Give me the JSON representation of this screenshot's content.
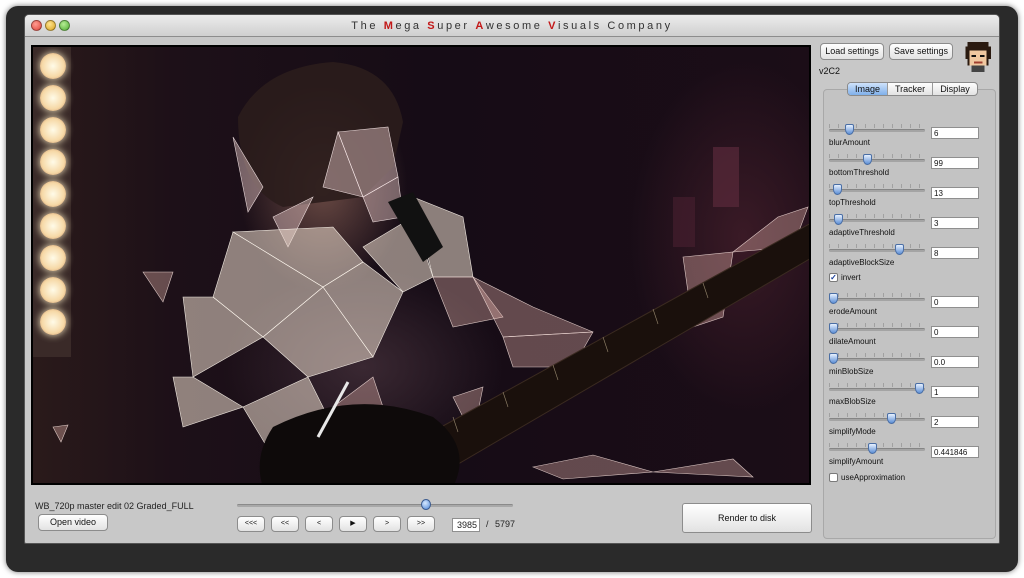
{
  "window": {
    "title_parts": [
      {
        "text": "The ",
        "hl": false
      },
      {
        "text": "M",
        "hl": true
      },
      {
        "text": "ega ",
        "hl": false
      },
      {
        "text": "S",
        "hl": true
      },
      {
        "text": "uper ",
        "hl": false
      },
      {
        "text": "A",
        "hl": true
      },
      {
        "text": "wesome ",
        "hl": false
      },
      {
        "text": "V",
        "hl": true
      },
      {
        "text": "isuals ",
        "hl": false
      },
      {
        "text": "Company",
        "hl": false
      }
    ],
    "accent_color": "#c21818"
  },
  "video": {
    "filename": "WB_720p master edit 02 Graded_FULL",
    "open_label": "Open video",
    "scrub_position": 0.685,
    "transport": [
      "<<<",
      "<<",
      "<",
      "▶",
      ">",
      ">>"
    ],
    "current_frame": "3985",
    "frame_separator": "/",
    "total_frames": "5797",
    "render_label": "Render to disk"
  },
  "panel": {
    "load_label": "Load settings",
    "save_label": "Save settings",
    "version": "v2C2",
    "tabs": [
      {
        "label": "Image",
        "active": true
      },
      {
        "label": "Tracker",
        "active": false
      },
      {
        "label": "Display",
        "active": false
      }
    ],
    "controls": [
      {
        "label": "blurAmount",
        "value": "6",
        "pos": 0.18
      },
      {
        "label": "bottomThreshold",
        "value": "99",
        "pos": 0.39
      },
      {
        "label": "topThreshold",
        "value": "13",
        "pos": 0.05
      },
      {
        "label": "adaptiveThreshold",
        "value": "3",
        "pos": 0.06
      },
      {
        "label": "adaptiveBlockSize",
        "value": "8",
        "pos": 0.75
      },
      {
        "label": "erodeAmount",
        "value": "0",
        "pos": 0.0
      },
      {
        "label": "dilateAmount",
        "value": "0",
        "pos": 0.0
      },
      {
        "label": "minBlobSize",
        "value": "0.0",
        "pos": 0.0
      },
      {
        "label": "maxBlobSize",
        "value": "1",
        "pos": 0.98
      },
      {
        "label": "simplifyMode",
        "value": "2",
        "pos": 0.66
      },
      {
        "label": "simplifyAmount",
        "value": "0.441846",
        "pos": 0.44
      }
    ],
    "invert_label": "invert",
    "invert_checked": true,
    "approx_label": "useApproximation",
    "approx_checked": false
  }
}
